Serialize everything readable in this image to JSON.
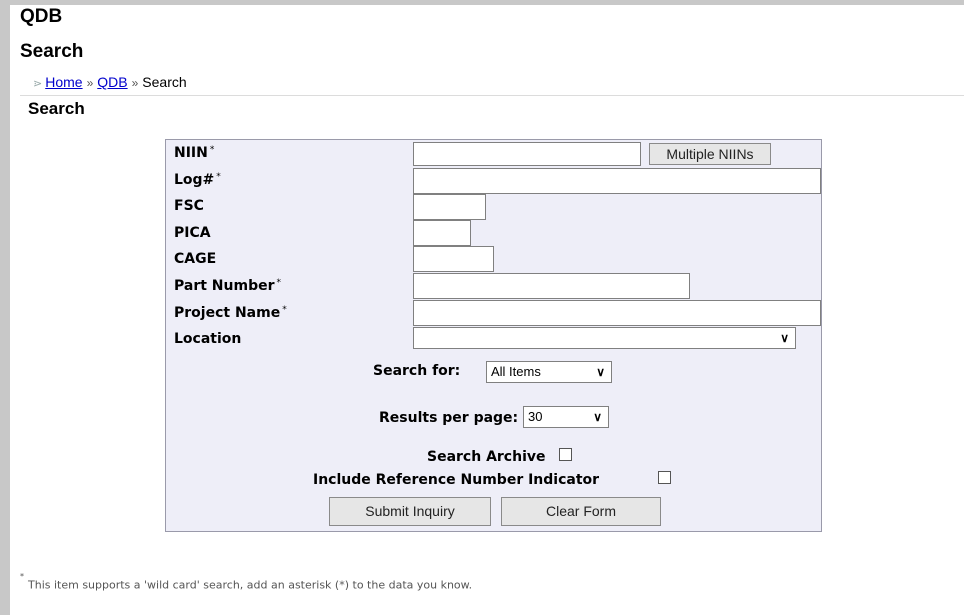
{
  "header": {
    "app_title": "QDB",
    "page_title": "Search"
  },
  "breadcrumb": {
    "home": "Home",
    "sep1": "»",
    "qdb": "QDB",
    "sep2": "»",
    "current": "Search"
  },
  "section_title": "Search",
  "form": {
    "fields": {
      "niin": {
        "label": "NIIN",
        "wildcard": "*",
        "value": ""
      },
      "log": {
        "label": "Log#",
        "wildcard": "*",
        "value": ""
      },
      "fsc": {
        "label": "FSC",
        "value": ""
      },
      "pica": {
        "label": "PICA",
        "value": ""
      },
      "cage": {
        "label": "CAGE",
        "value": ""
      },
      "part_number": {
        "label": "Part Number",
        "wildcard": "*",
        "value": ""
      },
      "project_name": {
        "label": "Project Name",
        "wildcard": "*",
        "value": ""
      },
      "location": {
        "label": "Location",
        "selected": ""
      }
    },
    "multiple_niins_label": "Multiple NIINs",
    "search_for": {
      "label": "Search for:",
      "selected": "All Items"
    },
    "results_per_page": {
      "label": "Results per page:",
      "selected": "30"
    },
    "search_archive": {
      "label": "Search Archive",
      "checked": false
    },
    "include_ref": {
      "label": "Include Reference Number Indicator",
      "checked": false
    },
    "submit_label": "Submit Inquiry",
    "clear_label": "Clear Form"
  },
  "footnote": {
    "mark": "*",
    "text": "This item supports a 'wild card' search, add an asterisk (*) to the data you know."
  }
}
